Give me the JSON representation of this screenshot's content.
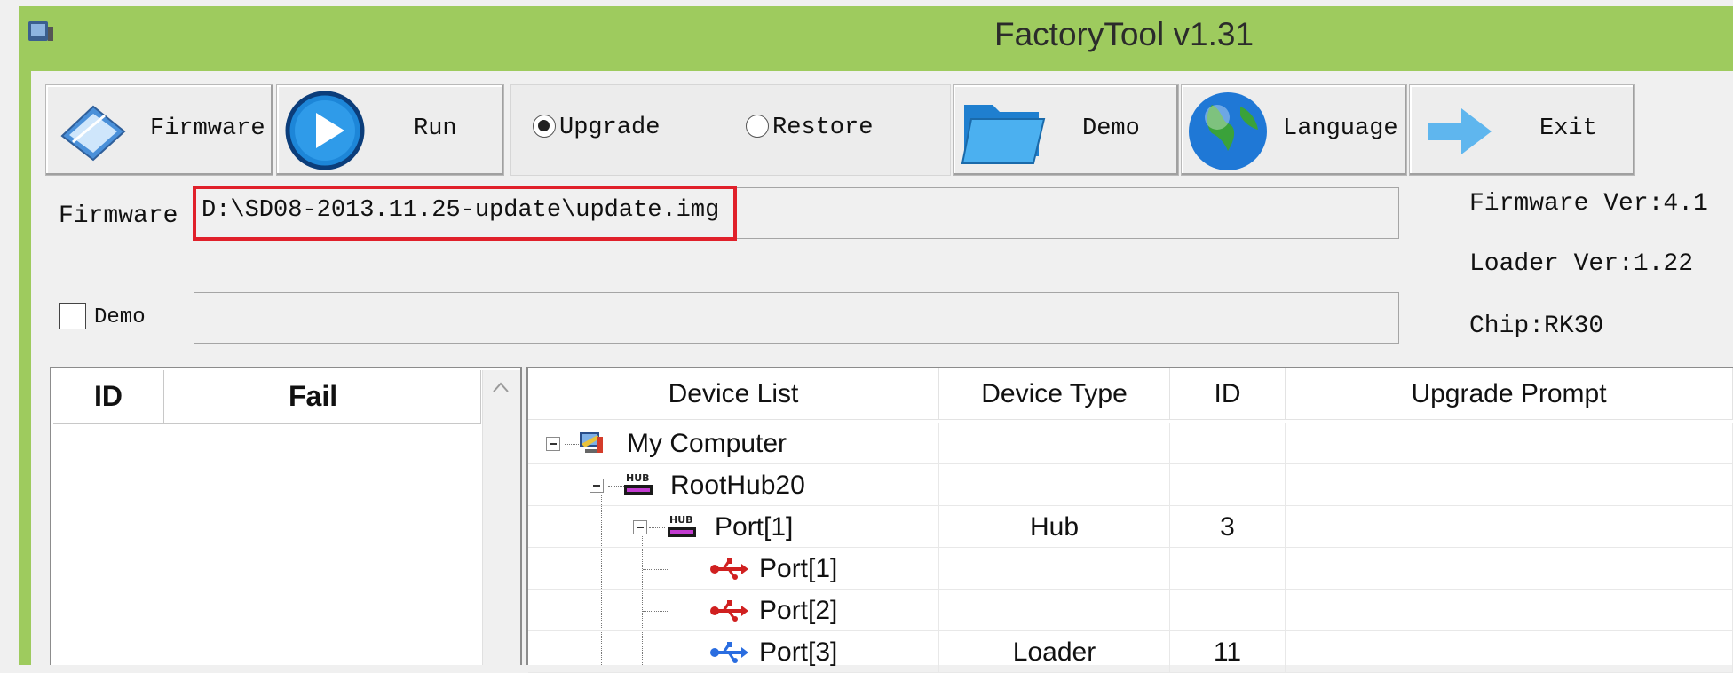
{
  "window": {
    "title": "FactoryTool v1.31"
  },
  "toolbar": {
    "firmware_label": "Firmware",
    "run_label": "Run",
    "mode": {
      "upgrade_label": "Upgrade",
      "restore_label": "Restore",
      "selected": "Upgrade"
    },
    "demo_label": "Demo",
    "language_label": "Language",
    "exit_label": "Exit"
  },
  "firmware": {
    "label": "Firmware",
    "path": "D:\\SD08-2013.11.25-update\\update.img"
  },
  "demo": {
    "label": "Demo",
    "checked": false,
    "path": ""
  },
  "info": {
    "firmware_ver": "Firmware Ver:4.1",
    "loader_ver": "Loader Ver:1.22",
    "chip": "Chip:RK30"
  },
  "fail_list": {
    "headers": {
      "id": "ID",
      "fail": "Fail"
    }
  },
  "device_table": {
    "headers": {
      "device_list": "Device List",
      "device_type": "Device Type",
      "id": "ID",
      "upgrade_prompt": "Upgrade Prompt"
    },
    "rows": [
      {
        "label": "My Computer",
        "type": "",
        "id": "",
        "prompt": ""
      },
      {
        "label": "RootHub20",
        "type": "",
        "id": "",
        "prompt": ""
      },
      {
        "label": "Port[1]",
        "type": "Hub",
        "id": "3",
        "prompt": ""
      },
      {
        "label": "Port[1]",
        "type": "",
        "id": "",
        "prompt": ""
      },
      {
        "label": "Port[2]",
        "type": "",
        "id": "",
        "prompt": ""
      },
      {
        "label": "Port[3]",
        "type": "Loader",
        "id": "11",
        "prompt": ""
      }
    ]
  },
  "colors": {
    "titlebar": "#9ecb5e",
    "highlight_box": "#e0202a",
    "usb_inactive": "#d02020",
    "usb_active": "#2a6de0"
  }
}
